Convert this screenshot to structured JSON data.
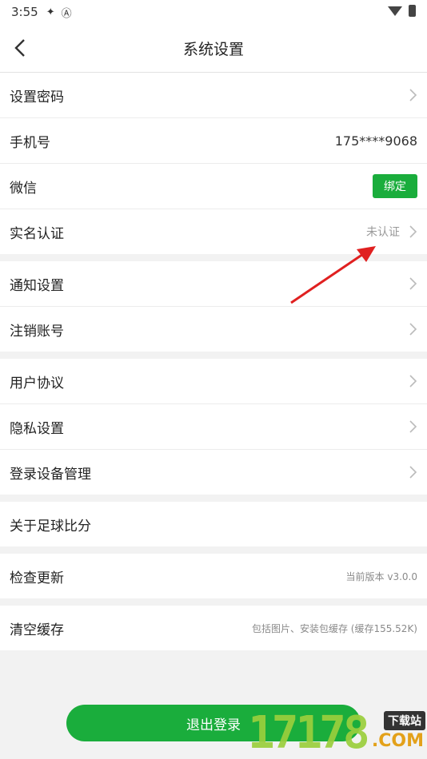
{
  "status_bar": {
    "time": "3:55"
  },
  "header": {
    "title": "系统设置"
  },
  "groups": [
    {
      "items": [
        {
          "label": "设置密码"
        },
        {
          "label": "手机号",
          "value": "175****9068"
        },
        {
          "label": "微信",
          "button": "绑定"
        },
        {
          "label": "实名认证",
          "value": "未认证"
        }
      ]
    },
    {
      "items": [
        {
          "label": "通知设置"
        },
        {
          "label": "注销账号"
        }
      ]
    },
    {
      "items": [
        {
          "label": "用户协议"
        },
        {
          "label": "隐私设置"
        },
        {
          "label": "登录设备管理"
        }
      ]
    },
    {
      "items": [
        {
          "label": "关于足球比分"
        }
      ]
    },
    {
      "items": [
        {
          "label": "检查更新",
          "value": "当前版本 v3.0.0"
        }
      ]
    },
    {
      "items": [
        {
          "label": "清空缓存",
          "value": "包括图片、安装包缓存 (缓存155.52K)"
        }
      ]
    }
  ],
  "logout": {
    "label": "退出登录"
  },
  "watermark": {
    "number": "17178",
    "tag": "下载站",
    "domain": ".COM"
  },
  "colors": {
    "accent": "#1aad3c",
    "annotation_arrow": "#e02020"
  }
}
